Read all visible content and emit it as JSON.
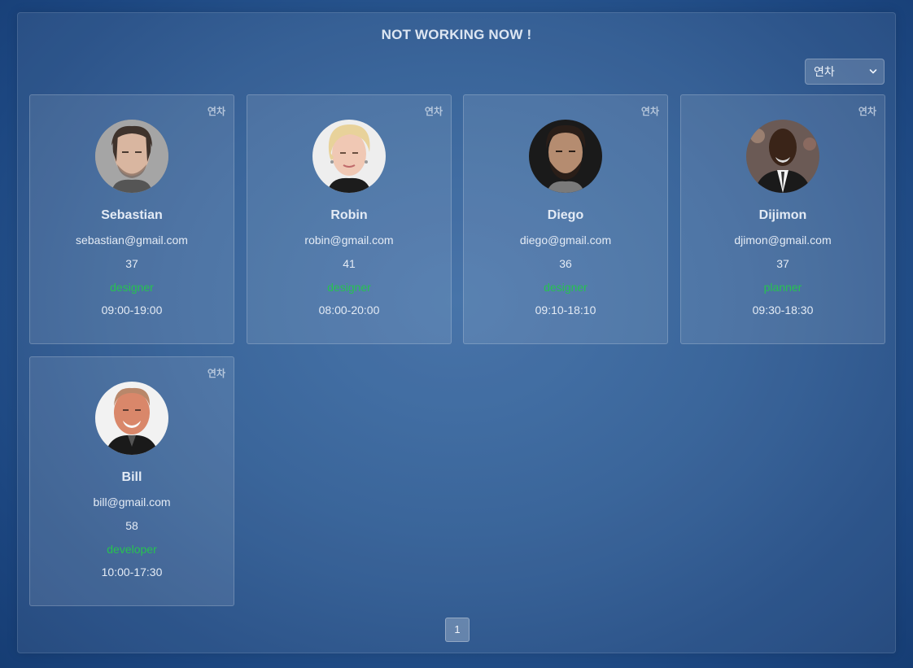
{
  "header": {
    "title": "NOT WORKING NOW !"
  },
  "filter": {
    "selected": "연차"
  },
  "employees": [
    {
      "badge": "연차",
      "name": "Sebastian",
      "email": "sebastian@gmail.com",
      "age": "37",
      "role": "designer",
      "hours": "09:00-19:00"
    },
    {
      "badge": "연차",
      "name": "Robin",
      "email": "robin@gmail.com",
      "age": "41",
      "role": "designer",
      "hours": "08:00-20:00"
    },
    {
      "badge": "연차",
      "name": "Diego",
      "email": "diego@gmail.com",
      "age": "36",
      "role": "designer",
      "hours": "09:10-18:10"
    },
    {
      "badge": "연차",
      "name": "Dijimon",
      "email": "djimon@gmail.com",
      "age": "37",
      "role": "planner",
      "hours": "09:30-18:30"
    },
    {
      "badge": "연차",
      "name": "Bill",
      "email": "bill@gmail.com",
      "age": "58",
      "role": "developer",
      "hours": "10:00-17:30"
    }
  ],
  "pagination": {
    "current": "1"
  },
  "colors": {
    "role_text": "#27c251",
    "background": "#2c5a93"
  }
}
